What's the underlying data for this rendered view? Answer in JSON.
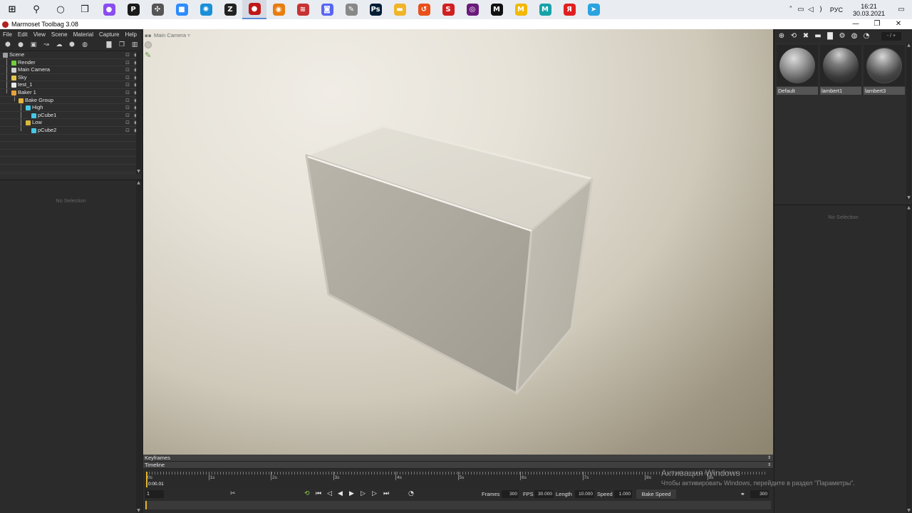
{
  "taskbar": {
    "apps": [
      {
        "icon": "windows-start-icon",
        "color": "#1a1a1a",
        "glyph": "⊞"
      },
      {
        "icon": "search-icon",
        "color": "#1a1a1a",
        "glyph": "⚲"
      },
      {
        "icon": "cortana-icon",
        "color": "#1a1a1a",
        "glyph": "○"
      },
      {
        "icon": "task-view-icon",
        "color": "#1a1a1a",
        "glyph": "❒"
      },
      {
        "icon": "alice-icon",
        "color": "#8a4df0",
        "glyph": "●"
      },
      {
        "icon": "app-p-icon",
        "color": "#1a1a1a",
        "glyph": "P"
      },
      {
        "icon": "app-bot-icon",
        "color": "#555555",
        "glyph": "✣"
      },
      {
        "icon": "zoom-icon",
        "color": "#2d8cff",
        "glyph": "■"
      },
      {
        "icon": "network-icon",
        "color": "#1a8fd8",
        "glyph": "✺"
      },
      {
        "icon": "zbrush-icon",
        "color": "#222222",
        "glyph": "Z"
      },
      {
        "icon": "marmoset-icon",
        "color": "#c01818",
        "glyph": "●"
      },
      {
        "icon": "blender-icon",
        "color": "#e87d0d",
        "glyph": "◉"
      },
      {
        "icon": "app-red-lines-icon",
        "color": "#c83232",
        "glyph": "≋"
      },
      {
        "icon": "discord-icon",
        "color": "#5865f2",
        "glyph": "◙"
      },
      {
        "icon": "app-brush-icon",
        "color": "#888888",
        "glyph": "✎"
      },
      {
        "icon": "photoshop-icon",
        "color": "#001e36",
        "glyph": "Ps"
      },
      {
        "icon": "folder-icon",
        "color": "#f0b429",
        "glyph": "▬"
      },
      {
        "icon": "app-orange-icon",
        "color": "#e8501a",
        "glyph": "↺"
      },
      {
        "icon": "steam-icon",
        "color": "#d02020",
        "glyph": "S"
      },
      {
        "icon": "obs-icon",
        "color": "#6a1b7a",
        "glyph": "◎"
      },
      {
        "icon": "app-m-black-icon",
        "color": "#111111",
        "glyph": "M"
      },
      {
        "icon": "app-m-yellow-icon",
        "color": "#f2b900",
        "glyph": "M"
      },
      {
        "icon": "app-m-teal-icon",
        "color": "#17a2a8",
        "glyph": "M"
      },
      {
        "icon": "yandex-icon",
        "color": "#e02020",
        "glyph": "Я"
      },
      {
        "icon": "telegram-icon",
        "color": "#2aa3e0",
        "glyph": "➤"
      }
    ],
    "tray": {
      "language": "РУС",
      "time": "16:21",
      "date": "30.03.2021"
    }
  },
  "titlebar": {
    "title": "Marmoset Toolbag 3.08",
    "minimize": "—",
    "maximize": "❐",
    "close": "✕"
  },
  "menu": [
    "File",
    "Edit",
    "View",
    "Scene",
    "Material",
    "Capture",
    "Help"
  ],
  "scene_toolbar": [
    "⬢",
    "●",
    "▣",
    "↝",
    "☁",
    "⬢",
    "◍",
    "▇",
    "❐",
    "▥"
  ],
  "outliner": [
    {
      "label": "Scene",
      "icon_color": "#9aa0a6"
    },
    {
      "label": "Render",
      "icon_color": "#6fcf3c"
    },
    {
      "label": "Main Camera",
      "icon_color": "#cfcfcf"
    },
    {
      "label": "Sky",
      "icon_color": "#e6c44a"
    },
    {
      "label": "test_1",
      "icon_color": "#e8e8e8"
    },
    {
      "label": "Baker 1",
      "icon_color": "#e8a23a"
    },
    {
      "label": "Bake Group",
      "icon_color": "#e5b23b"
    },
    {
      "label": "High",
      "icon_color": "#46c7e6"
    },
    {
      "label": "pCube1",
      "icon_color": "#46c7e6"
    },
    {
      "label": "Low",
      "icon_color": "#d9b83a"
    },
    {
      "label": "pCube2",
      "icon_color": "#46c7e6"
    }
  ],
  "left_properties": {
    "empty_text": "No Selection"
  },
  "viewport": {
    "camera_label": "Main Camera ▿"
  },
  "materials": {
    "toolbar": [
      "⊕",
      "⟲",
      "✖",
      "▬",
      "▇",
      "⚙",
      "◍",
      "◔"
    ],
    "search_placeholder": "- / +",
    "items": [
      {
        "name": "Default"
      },
      {
        "name": "lambert1"
      },
      {
        "name": "lambert3"
      }
    ]
  },
  "right_properties": {
    "empty_text": "No Selection"
  },
  "timeline": {
    "keyframes_label": "Keyframes",
    "timeline_label": "Timeline",
    "ticks": [
      "0s",
      "1s",
      "2s",
      "3s",
      "4s",
      "5s",
      "6s",
      "7s",
      "8s",
      "9s"
    ],
    "current_time": "0:00.01",
    "frame": "1",
    "frames_label": "Frames",
    "frames": "300",
    "fps_label": "FPS",
    "fps": "30.000",
    "length_label": "Length",
    "length": "10.000",
    "speed_label": "Speed",
    "speed": "1.000",
    "bake_speed": "Bake Speed",
    "end_frame": "300"
  },
  "activation": {
    "title": "Активация Windows",
    "subtitle": "Чтобы активировать Windows, перейдите в раздел \"Параметры\"."
  }
}
